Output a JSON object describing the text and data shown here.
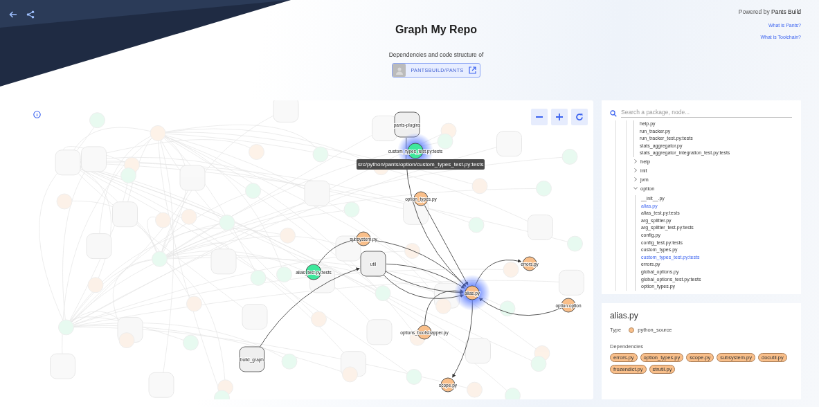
{
  "header": {
    "title": "Graph My Repo",
    "subtitle": "Dependencies and code structure of",
    "repo": "PANTSBUILD/PANTS",
    "powered_by": "Powered by **Pants Build**",
    "links": [
      "What is Pants?",
      "What is Toolchain?"
    ]
  },
  "graph": {
    "nodes": [
      {
        "label": "pants-plugins",
        "kind": "package",
        "focused": false
      },
      {
        "label": "custom_types_test.py:tests",
        "kind": "test",
        "focused": true
      },
      {
        "label": "option_types.py",
        "kind": "source",
        "focused": false
      },
      {
        "label": "subsystem.py",
        "kind": "source",
        "focused": false
      },
      {
        "label": "util",
        "kind": "package",
        "focused": false
      },
      {
        "label": "alias_test.py:tests",
        "kind": "test",
        "focused": false
      },
      {
        "label": "alias.py",
        "kind": "source",
        "focused": true
      },
      {
        "label": "errors.py",
        "kind": "source",
        "focused": false
      },
      {
        "label": "option.option",
        "kind": "source",
        "focused": false
      },
      {
        "label": "options_bootstrapper.py",
        "kind": "source",
        "focused": false
      },
      {
        "label": "build_graph",
        "kind": "package",
        "focused": false
      },
      {
        "label": "scope.py",
        "kind": "source",
        "focused": false
      }
    ],
    "tooltip": "src/python/pants/option/custom_types_test.py:tests"
  },
  "search": {
    "placeholder": "Search a package, node..."
  },
  "tree": [
    {
      "children": [
        {
          "label": "help.py",
          "selected": false
        },
        {
          "label": "run_tracker.py",
          "selected": false
        },
        {
          "label": "run_tracker_test.py:tests",
          "selected": false
        },
        {
          "label": "stats_aggregator.py",
          "selected": false
        },
        {
          "label": "stats_aggregator_integration_test.py:tests",
          "selected": false
        }
      ]
    },
    {
      "label": "help",
      "expanded": false
    },
    {
      "label": "init",
      "expanded": false
    },
    {
      "label": "jvm",
      "expanded": false
    },
    {
      "label": "option",
      "expanded": true,
      "children": [
        {
          "label": "__init__.py",
          "selected": false
        },
        {
          "label": "alias.py",
          "selected": true
        },
        {
          "label": "alias_test.py:tests",
          "selected": false
        },
        {
          "label": "arg_splitter.py",
          "selected": false
        },
        {
          "label": "arg_splitter_test.py:tests",
          "selected": false
        },
        {
          "label": "config.py",
          "selected": false
        },
        {
          "label": "config_test.py:tests",
          "selected": false
        },
        {
          "label": "custom_types.py",
          "selected": false
        },
        {
          "label": "custom_types_test.py:tests",
          "selected": true
        },
        {
          "label": "errors.py",
          "selected": false
        },
        {
          "label": "global_options.py",
          "selected": false
        },
        {
          "label": "global_options_test.py:tests",
          "selected": false
        },
        {
          "label": "option_types.py",
          "selected": false
        }
      ]
    }
  ],
  "details": {
    "title": "alias.py",
    "type_label": "Type",
    "type": {
      "name": "python_source",
      "color": "#f9bf8a"
    },
    "dependencies_label": "Dependencies",
    "dependencies": [
      "errors.py",
      "option_types.py",
      "scope.py",
      "subsystem.py",
      "docutil.py",
      "frozendict.py",
      "strutil.py"
    ]
  }
}
